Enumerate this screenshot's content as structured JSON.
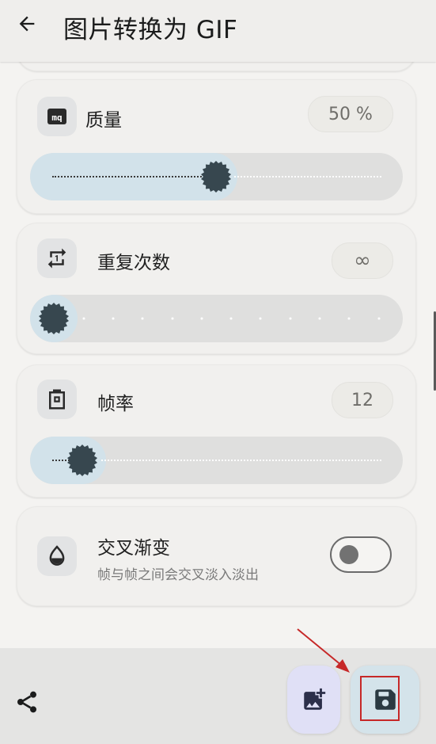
{
  "header": {
    "title": "图片转换为 GIF"
  },
  "settings": {
    "quality": {
      "label": "质量",
      "value": "50 %",
      "level": 0.5
    },
    "repeat": {
      "label": "重复次数",
      "value": "∞",
      "level": 0.0
    },
    "fps": {
      "label": "帧率",
      "value": "12",
      "level": 0.09
    },
    "crossfade": {
      "label": "交叉渐变",
      "description": "帧与帧之间会交叉淡入淡出",
      "enabled": false
    }
  },
  "colors": {
    "accent_fill": "#d2e2ea",
    "thumb": "#37474f",
    "highlight": "#c62828"
  },
  "icons": [
    "back-arrow-icon",
    "quality-icon",
    "repeat-icon",
    "frame-rate-icon",
    "crossfade-drop-icon",
    "share-icon",
    "add-image-icon",
    "save-icon"
  ]
}
